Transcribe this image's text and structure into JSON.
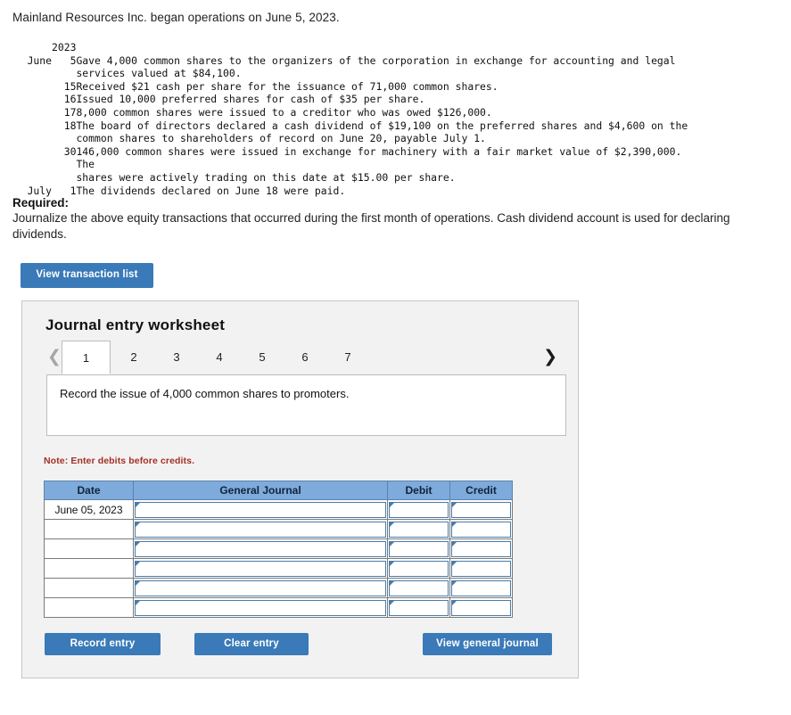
{
  "intro": "Mainland Resources Inc. began operations on June 5, 2023.",
  "transactions": {
    "year": "2023",
    "rows": [
      {
        "month": "June",
        "day": "5",
        "line1": "Gave 4,000 common shares to the organizers of the corporation in exchange for accounting and legal",
        "line2": "services valued at $84,100."
      },
      {
        "month": "",
        "day": "15",
        "line1": "Received $21 cash per share for the issuance of 71,000 common shares.",
        "line2": ""
      },
      {
        "month": "",
        "day": "16",
        "line1": "Issued 10,000 preferred shares for cash of $35 per share.",
        "line2": ""
      },
      {
        "month": "",
        "day": "17",
        "line1": "8,000 common shares were issued to a creditor who was owed $126,000.",
        "line2": ""
      },
      {
        "month": "",
        "day": "18",
        "line1": "The board of directors declared a cash dividend of $19,100 on the preferred shares and $4,600 on the",
        "line2": "common shares to shareholders of record on June 20, payable July 1."
      },
      {
        "month": "",
        "day": "30",
        "line1": "146,000 common shares were issued in exchange for machinery with a fair market value of $2,390,000. The",
        "line2": "shares were actively trading on this date at $15.00 per share."
      },
      {
        "month": "July",
        "day": "1",
        "line1": "The dividends declared on June 18 were paid.",
        "line2": ""
      }
    ]
  },
  "required": {
    "heading": "Required:",
    "body": "Journalize the above equity transactions that occurred during the first month of operations. Cash dividend account is used for declaring dividends."
  },
  "view_transaction_list_label": "View transaction list",
  "worksheet": {
    "title": "Journal entry worksheet",
    "prev_icon": "chevron-left",
    "next_icon": "chevron-right",
    "tabs": [
      {
        "label": "1",
        "active": true
      },
      {
        "label": "2",
        "active": false
      },
      {
        "label": "3",
        "active": false
      },
      {
        "label": "4",
        "active": false
      },
      {
        "label": "5",
        "active": false
      },
      {
        "label": "6",
        "active": false
      },
      {
        "label": "7",
        "active": false
      }
    ],
    "prompt": "Record the issue of 4,000 common shares to promoters.",
    "note": "Note: Enter debits before credits.",
    "table": {
      "headers": [
        "Date",
        "General Journal",
        "Debit",
        "Credit"
      ],
      "rows": [
        {
          "date": "June 05, 2023",
          "general_journal": "",
          "debit": "",
          "credit": ""
        },
        {
          "date": "",
          "general_journal": "",
          "debit": "",
          "credit": ""
        },
        {
          "date": "",
          "general_journal": "",
          "debit": "",
          "credit": ""
        },
        {
          "date": "",
          "general_journal": "",
          "debit": "",
          "credit": ""
        },
        {
          "date": "",
          "general_journal": "",
          "debit": "",
          "credit": ""
        },
        {
          "date": "",
          "general_journal": "",
          "debit": "",
          "credit": ""
        }
      ]
    },
    "buttons": {
      "record": "Record entry",
      "clear": "Clear entry",
      "view_general_journal": "View general journal"
    }
  },
  "colors": {
    "button_blue": "#3a7ab8",
    "table_header_blue": "#7eaadc",
    "panel_bg": "#f2f2f2",
    "note_red": "#a33026",
    "input_border_blue": "#4a7ca8"
  }
}
